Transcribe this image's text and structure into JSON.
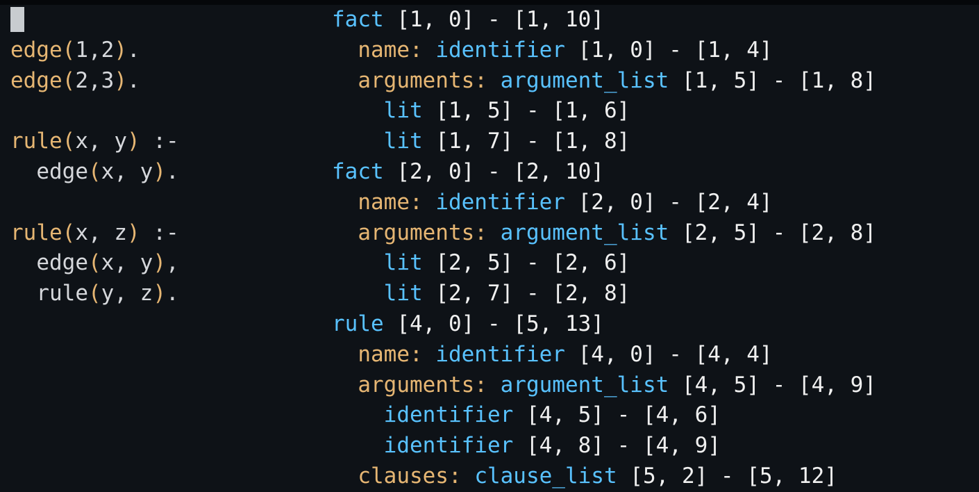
{
  "colors": {
    "background": "#0e1217",
    "node_type": "#59c2ff",
    "field_and_functor": "#e6b673",
    "plain_text": "#d6d8dc",
    "cursor": "#c8ccd0"
  },
  "source_pane": {
    "lines": [
      {
        "tokens": []
      },
      {
        "tokens": [
          [
            "fn",
            "edge"
          ],
          [
            "pn",
            "("
          ],
          [
            "id",
            "1"
          ],
          [
            "op",
            ","
          ],
          [
            "id",
            "2"
          ],
          [
            "pn",
            ")"
          ],
          [
            "op",
            "."
          ]
        ]
      },
      {
        "tokens": [
          [
            "fn",
            "edge"
          ],
          [
            "pn",
            "("
          ],
          [
            "id",
            "2"
          ],
          [
            "op",
            ","
          ],
          [
            "id",
            "3"
          ],
          [
            "pn",
            ")"
          ],
          [
            "op",
            "."
          ]
        ]
      },
      {
        "tokens": []
      },
      {
        "tokens": [
          [
            "fn",
            "rule"
          ],
          [
            "pn",
            "("
          ],
          [
            "id",
            "x"
          ],
          [
            "op",
            ", "
          ],
          [
            "id",
            "y"
          ],
          [
            "pn",
            ")"
          ],
          [
            "op",
            " :-"
          ]
        ]
      },
      {
        "tokens": [
          [
            "sp",
            "  "
          ],
          [
            "id",
            "edge"
          ],
          [
            "pn",
            "("
          ],
          [
            "id",
            "x"
          ],
          [
            "op",
            ", "
          ],
          [
            "id",
            "y"
          ],
          [
            "pn",
            ")"
          ],
          [
            "op",
            "."
          ]
        ]
      },
      {
        "tokens": []
      },
      {
        "tokens": [
          [
            "fn",
            "rule"
          ],
          [
            "pn",
            "("
          ],
          [
            "id",
            "x"
          ],
          [
            "op",
            ", "
          ],
          [
            "id",
            "z"
          ],
          [
            "pn",
            ")"
          ],
          [
            "op",
            " :-"
          ]
        ]
      },
      {
        "tokens": [
          [
            "sp",
            "  "
          ],
          [
            "id",
            "edge"
          ],
          [
            "pn",
            "("
          ],
          [
            "id",
            "x"
          ],
          [
            "op",
            ", "
          ],
          [
            "id",
            "y"
          ],
          [
            "pn",
            ")"
          ],
          [
            "op",
            ","
          ]
        ]
      },
      {
        "tokens": [
          [
            "sp",
            "  "
          ],
          [
            "id",
            "rule"
          ],
          [
            "pn",
            "("
          ],
          [
            "id",
            "y"
          ],
          [
            "op",
            ", "
          ],
          [
            "id",
            "z"
          ],
          [
            "pn",
            ")"
          ],
          [
            "op",
            "."
          ]
        ]
      }
    ]
  },
  "syntax_tree_pane": {
    "lines": [
      {
        "indent": "",
        "field": "",
        "node": "fact",
        "range": " [1, 0] - [1, 10]"
      },
      {
        "indent": "  ",
        "field": "name: ",
        "node": "identifier",
        "range": " [1, 0] - [1, 4]"
      },
      {
        "indent": "  ",
        "field": "arguments: ",
        "node": "argument_list",
        "range": " [1, 5] - [1, 8]"
      },
      {
        "indent": "    ",
        "field": "",
        "node": "lit",
        "range": " [1, 5] - [1, 6]"
      },
      {
        "indent": "    ",
        "field": "",
        "node": "lit",
        "range": " [1, 7] - [1, 8]"
      },
      {
        "indent": "",
        "field": "",
        "node": "fact",
        "range": " [2, 0] - [2, 10]"
      },
      {
        "indent": "  ",
        "field": "name: ",
        "node": "identifier",
        "range": " [2, 0] - [2, 4]"
      },
      {
        "indent": "  ",
        "field": "arguments: ",
        "node": "argument_list",
        "range": " [2, 5] - [2, 8]"
      },
      {
        "indent": "    ",
        "field": "",
        "node": "lit",
        "range": " [2, 5] - [2, 6]"
      },
      {
        "indent": "    ",
        "field": "",
        "node": "lit",
        "range": " [2, 7] - [2, 8]"
      },
      {
        "indent": "",
        "field": "",
        "node": "rule",
        "range": " [4, 0] - [5, 13]"
      },
      {
        "indent": "  ",
        "field": "name: ",
        "node": "identifier",
        "range": " [4, 0] - [4, 4]"
      },
      {
        "indent": "  ",
        "field": "arguments: ",
        "node": "argument_list",
        "range": " [4, 5] - [4, 9]"
      },
      {
        "indent": "    ",
        "field": "",
        "node": "identifier",
        "range": " [4, 5] - [4, 6]"
      },
      {
        "indent": "    ",
        "field": "",
        "node": "identifier",
        "range": " [4, 8] - [4, 9]"
      },
      {
        "indent": "  ",
        "field": "clauses: ",
        "node": "clause_list",
        "range": " [5, 2] - [5, 12]"
      }
    ]
  }
}
